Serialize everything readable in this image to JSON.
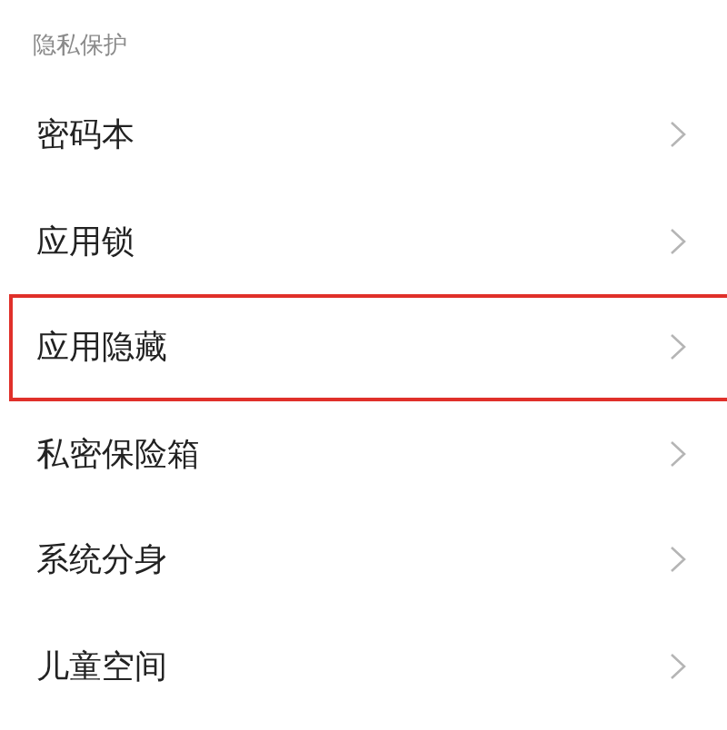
{
  "section": {
    "title": "隐私保护"
  },
  "items": [
    {
      "label": "密码本",
      "highlighted": false
    },
    {
      "label": "应用锁",
      "highlighted": false
    },
    {
      "label": "应用隐藏",
      "highlighted": true
    },
    {
      "label": "私密保险箱",
      "highlighted": false
    },
    {
      "label": "系统分身",
      "highlighted": false
    },
    {
      "label": "儿童空间",
      "highlighted": false
    }
  ]
}
